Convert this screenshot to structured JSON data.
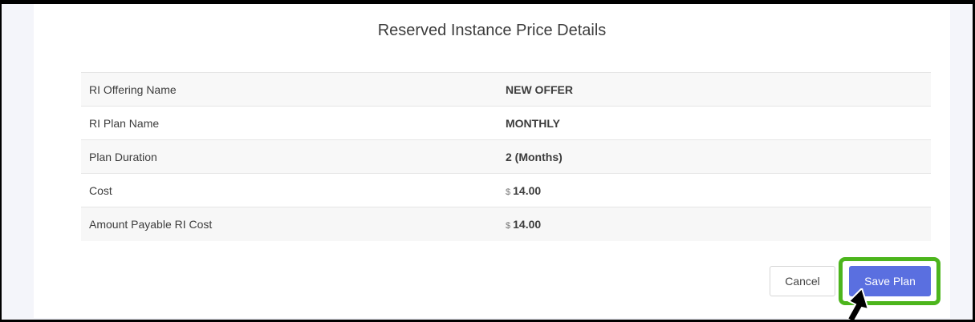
{
  "dialog": {
    "title": "Reserved Instance Price Details"
  },
  "details": [
    {
      "label": "RI Offering Name",
      "value": "NEW OFFER"
    },
    {
      "label": "RI Plan Name",
      "value": "MONTHLY"
    },
    {
      "label": "Plan Duration",
      "value": "2 (Months)"
    },
    {
      "label": "Cost",
      "currency": "$",
      "value": "14.00"
    },
    {
      "label": "Amount Payable RI Cost",
      "currency": "$",
      "value": "14.00"
    }
  ],
  "buttons": {
    "cancel_label": "Cancel",
    "save_label": "Save Plan"
  },
  "colors": {
    "accent": "#5a6fe0",
    "highlight_text": "#4a5fc1",
    "annotation_outline": "#4cb51c"
  }
}
